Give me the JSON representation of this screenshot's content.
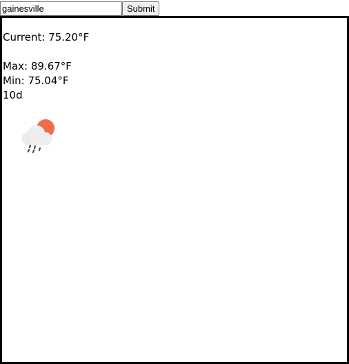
{
  "search": {
    "value": "gainesville",
    "submit_label": "Submit"
  },
  "weather": {
    "current": "Current: 75.20°F",
    "max": "Max: 89.67°F",
    "min": "Min: 75.04°F",
    "icon_code": "10d",
    "icon": "sun-behind-rain-cloud-icon"
  },
  "colors": {
    "border": "#000000",
    "sun": "#ef6d4c",
    "cloud": "#eeeeee",
    "rain": "#444444"
  }
}
